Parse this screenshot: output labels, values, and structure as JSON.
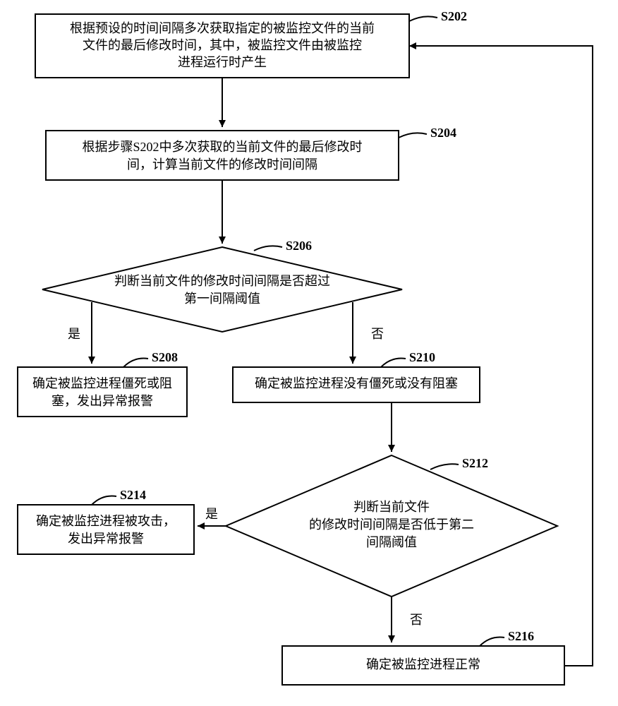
{
  "chart_data": {
    "type": "flowchart",
    "nodes": [
      {
        "id": "S202",
        "shape": "rect",
        "text": "根据预设的时间间隔多次获取指定的被监控文件的当前文件的最后修改时间，其中，被监控文件由被监控进程运行时产生"
      },
      {
        "id": "S204",
        "shape": "rect",
        "text": "根据步骤S202中多次获取的当前文件的最后修改时间，计算当前文件的修改时间间隔"
      },
      {
        "id": "S206",
        "shape": "diamond",
        "text": "判断当前文件的修改时间间隔是否超过第一间隔阈值"
      },
      {
        "id": "S208",
        "shape": "rect",
        "text": "确定被监控进程僵死或阻塞，发出异常报警"
      },
      {
        "id": "S210",
        "shape": "rect",
        "text": "确定被监控进程没有僵死或没有阻塞"
      },
      {
        "id": "S212",
        "shape": "diamond",
        "text": "判断当前文件的修改时间间隔是否低于第二间隔阈值"
      },
      {
        "id": "S214",
        "shape": "rect",
        "text": "确定被监控进程被攻击，发出异常报警"
      },
      {
        "id": "S216",
        "shape": "rect",
        "text": "确定被监控进程正常"
      }
    ],
    "edges": [
      {
        "from": "S202",
        "to": "S204",
        "label": ""
      },
      {
        "from": "S204",
        "to": "S206",
        "label": ""
      },
      {
        "from": "S206",
        "to": "S208",
        "label": "是"
      },
      {
        "from": "S206",
        "to": "S210",
        "label": "否"
      },
      {
        "from": "S210",
        "to": "S212",
        "label": ""
      },
      {
        "from": "S212",
        "to": "S214",
        "label": "是"
      },
      {
        "from": "S212",
        "to": "S216",
        "label": "否"
      },
      {
        "from": "S216",
        "to": "S202",
        "label": ""
      }
    ]
  },
  "labels": {
    "s202": "S202",
    "s204": "S204",
    "s206": "S206",
    "s208": "S208",
    "s210": "S210",
    "s212": "S212",
    "s214": "S214",
    "s216": "S216",
    "yes": "是",
    "no": "否"
  },
  "text": {
    "s202_l1": "根据预设的时间间隔多次获取指定的被监控文件的当前",
    "s202_l2": "文件的最后修改时间，其中，被监控文件由被监控",
    "s202_l3": "进程运行时产生",
    "s204_l1": "根据步骤S202中多次获取的当前文件的最后修改时",
    "s204_l2": "间，计算当前文件的修改时间间隔",
    "s206_l1": "判断当前文件的修改时间间隔是否超过",
    "s206_l2": "第一间隔阈值",
    "s208_l1": "确定被监控进程僵死或阻",
    "s208_l2": "塞，发出异常报警",
    "s210_l1": "确定被监控进程没有僵死或没有阻塞",
    "s212_l1": "判断当前文件",
    "s212_l2": "的修改时间间隔是否低于第二",
    "s212_l3": "间隔阈值",
    "s214_l1": "确定被监控进程被攻击，",
    "s214_l2": "发出异常报警",
    "s216_l1": "确定被监控进程正常"
  }
}
